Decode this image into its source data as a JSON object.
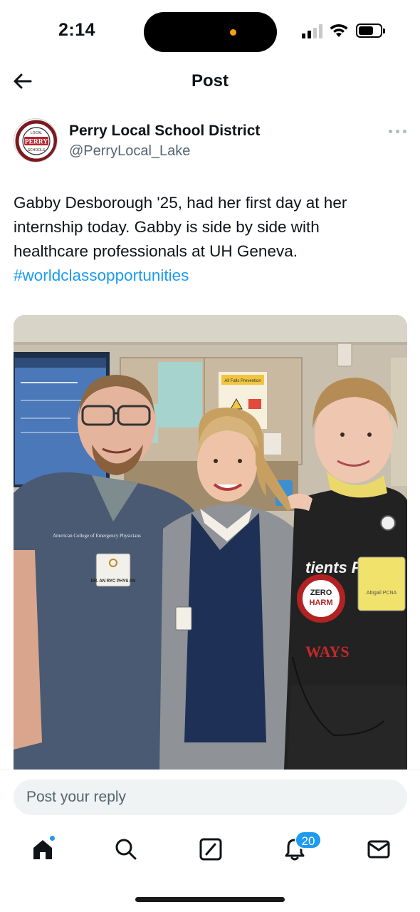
{
  "status_bar": {
    "time": "2:14"
  },
  "header": {
    "title": "Post",
    "back_icon": "arrow-left-icon"
  },
  "author": {
    "name": "Perry Local School District",
    "handle": "@PerryLocal_Lake",
    "avatar_text": "PERRY",
    "avatar_ring_top": "WORLD-CLASS OPPORTUNITIES",
    "avatar_ring_bottom": "HOMETOWN PRIDE"
  },
  "tweet": {
    "line1": "Gabby Desborough '25, had her first day at her",
    "line2": "internship today. Gabby is side by side with",
    "line3": "healthcare professionals at UH Geneva.",
    "hashtag": "#worldclassopportunities"
  },
  "photo": {
    "description_icon": "photo-image",
    "poster_title": "All Falls Prevention",
    "shirt_text": "tients F",
    "badge_line1": "ZERO",
    "badge_line2": "HARM",
    "shirt_bottom": "WAYS",
    "badge_ring_left": "Safe",
    "badge_ring_right": "Work Safe",
    "badge_ring_bottom": "Home Safe",
    "scrub_text": "American College of Emergency Physicians",
    "name_tag": "DR. AN   RYC PHYS   AN",
    "id_card_text": "Abigail PCNA"
  },
  "reply": {
    "placeholder": "Post your reply"
  },
  "nav": {
    "items": [
      "home-icon",
      "search-icon",
      "compose-icon",
      "notifications-icon",
      "messages-icon"
    ],
    "notification_count": "20"
  },
  "colors": {
    "accent": "#1d9bf0",
    "text": "#0f1419",
    "secondary": "#536471"
  }
}
